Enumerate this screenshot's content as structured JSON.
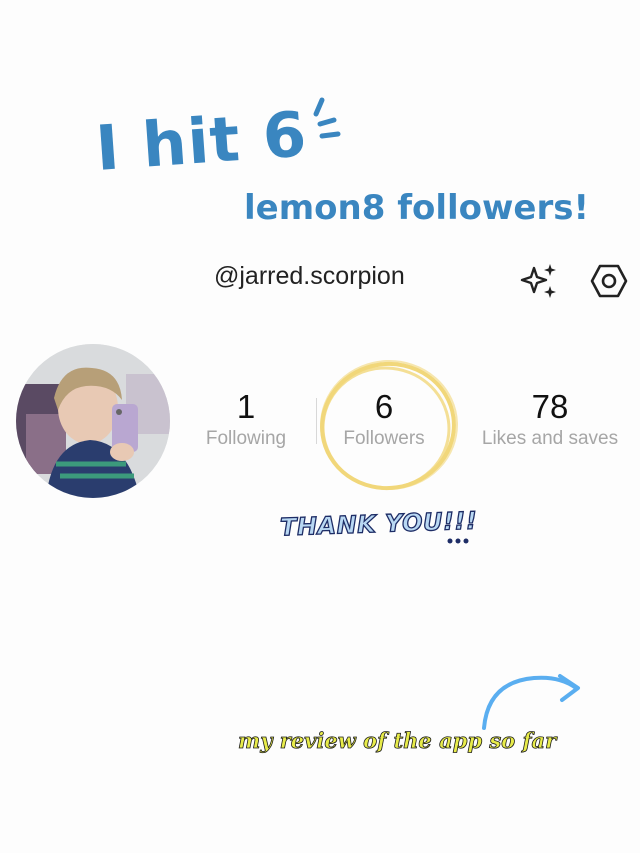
{
  "header": {
    "title_line1": "I hit 6",
    "title_line2": "lemon8 followers!"
  },
  "profile": {
    "username": "@jarred.scorpion",
    "stats": [
      {
        "value": "1",
        "label": "Following"
      },
      {
        "value": "6",
        "label": "Followers"
      },
      {
        "value": "78",
        "label": "Likes and saves"
      }
    ]
  },
  "annotations": {
    "thank_you": "THANK YOU!!!",
    "review": "my review of the app so far"
  },
  "icons": {
    "top_right": [
      "sparkle-icon",
      "settings-icon"
    ]
  },
  "colors": {
    "title_blue": "#3a86c0",
    "scribble_yellow": "#f1d77a",
    "review_yellow": "#e8ec4a",
    "arrow_blue": "#5aaef0",
    "thank_you_fill": "#b9d8f3"
  }
}
